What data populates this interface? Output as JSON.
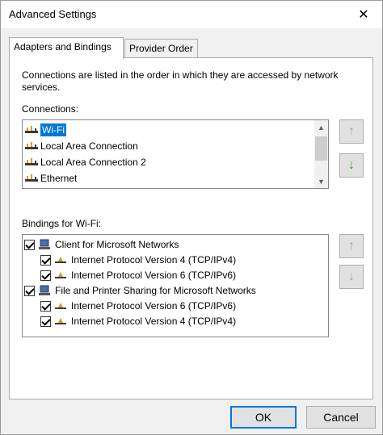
{
  "window": {
    "title": "Advanced Settings",
    "close_glyph": "✕"
  },
  "tabs": [
    {
      "label": "Adapters and Bindings",
      "active": true
    },
    {
      "label": "Provider Order",
      "active": false
    }
  ],
  "panel": {
    "description": "Connections are listed in the order in which they are accessed by network services.",
    "connections_label": "Connections:",
    "connections": [
      {
        "label": "Wi-Fi",
        "selected": true
      },
      {
        "label": "Local Area Connection",
        "selected": false
      },
      {
        "label": "Local Area Connection 2",
        "selected": false
      },
      {
        "label": "Ethernet",
        "selected": false
      }
    ],
    "connections_buttons": {
      "up_glyph": "↑",
      "down_glyph": "↓"
    },
    "bindings_label": "Bindings for Wi-Fi:",
    "bindings": [
      {
        "label": "Client for Microsoft Networks",
        "checked": true,
        "level": 0,
        "icon": "client-network-icon"
      },
      {
        "label": "Internet Protocol Version 4 (TCP/IPv4)",
        "checked": true,
        "level": 1,
        "icon": "protocol-icon"
      },
      {
        "label": "Internet Protocol Version 6 (TCP/IPv6)",
        "checked": true,
        "level": 1,
        "icon": "protocol-icon"
      },
      {
        "label": "File and Printer Sharing for Microsoft Networks",
        "checked": true,
        "level": 0,
        "icon": "file-printer-sharing-icon"
      },
      {
        "label": "Internet Protocol Version 6 (TCP/IPv6)",
        "checked": true,
        "level": 1,
        "icon": "protocol-icon"
      },
      {
        "label": "Internet Protocol Version 4 (TCP/IPv4)",
        "checked": true,
        "level": 1,
        "icon": "protocol-icon"
      }
    ],
    "bindings_buttons": {
      "up_glyph": "↑",
      "down_glyph": "↓"
    }
  },
  "footer": {
    "ok_label": "OK",
    "cancel_label": "Cancel"
  },
  "colors": {
    "selection": "#0078d7",
    "enabled_arrow": "#2aa52a",
    "disabled_arrow": "#a0a0a0"
  }
}
